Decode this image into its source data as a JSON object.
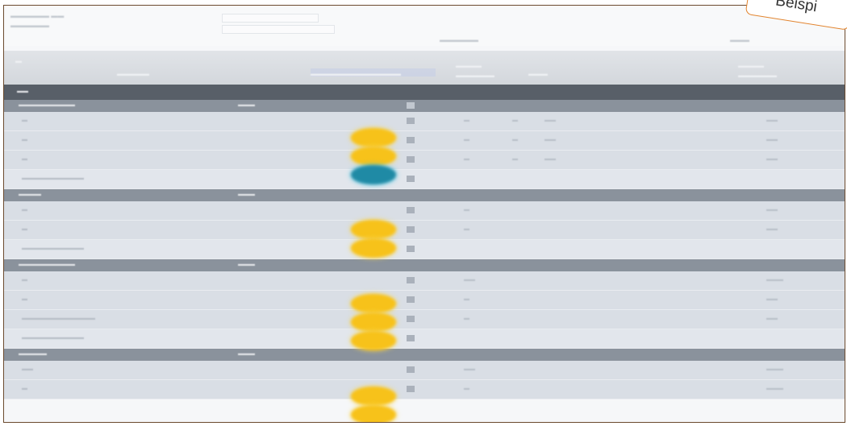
{
  "ribbon": {
    "label": "Beispi"
  },
  "colors": {
    "group_header": "#8a929c",
    "row": "#d9dee5",
    "status_yellow": "#f7c21a",
    "status_teal": "#1f8aa5",
    "frame_border": "#6b4a2e",
    "ribbon_border": "#e2842e"
  },
  "groups": [
    {
      "rows": [
        {
          "status": "yellow"
        },
        {
          "status": "yellow"
        },
        {
          "status": "teal"
        },
        {
          "status": "none"
        }
      ]
    },
    {
      "rows": [
        {
          "status": "yellow"
        },
        {
          "status": "yellow"
        },
        {
          "status": "none"
        }
      ]
    },
    {
      "rows": [
        {
          "status": "yellow"
        },
        {
          "status": "yellow"
        },
        {
          "status": "yellow"
        },
        {
          "status": "none"
        }
      ]
    },
    {
      "rows": [
        {
          "status": "yellow"
        },
        {
          "status": "yellow"
        }
      ]
    }
  ]
}
